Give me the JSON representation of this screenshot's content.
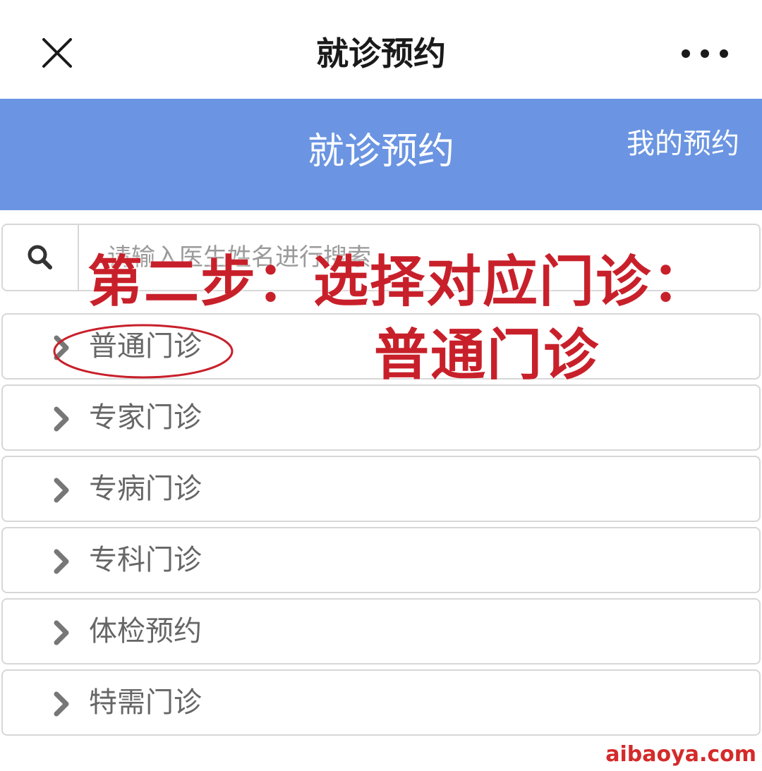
{
  "header": {
    "title": "就诊预约",
    "close_icon": "close-icon",
    "more_icon": "more-icon"
  },
  "banner": {
    "title": "就诊预约",
    "my_appointments_label": "我的预约",
    "color": "#6b95e2"
  },
  "search": {
    "icon": "search-icon",
    "placeholder": "请输入医生姓名进行搜索"
  },
  "clinic_list": {
    "items": [
      {
        "label": "普通门诊"
      },
      {
        "label": "专家门诊"
      },
      {
        "label": "专病门诊"
      },
      {
        "label": "专科门诊"
      },
      {
        "label": "体检预约"
      },
      {
        "label": "特需门诊"
      }
    ]
  },
  "annotation": {
    "line1": "第二步：选择对应门诊：",
    "line2": "普通门诊",
    "color": "#c8202a"
  },
  "watermark": "aibaoya.com"
}
